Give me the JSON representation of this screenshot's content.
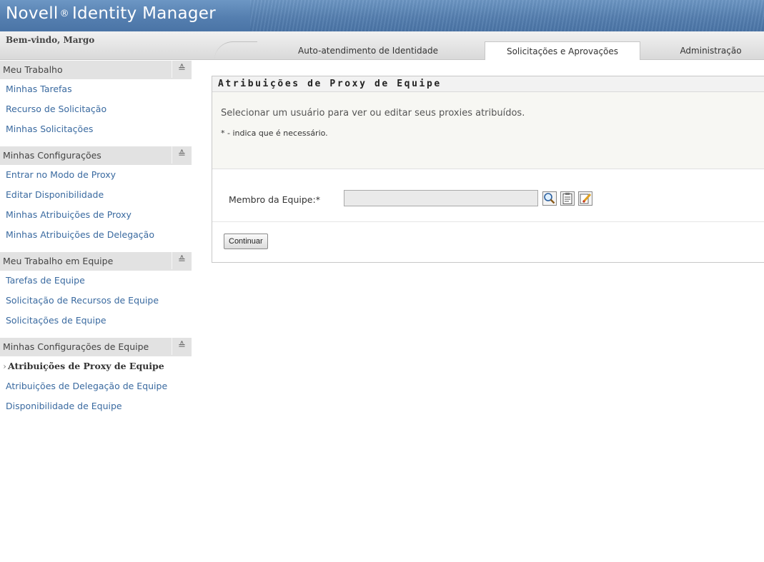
{
  "header": {
    "brand": "Novell",
    "registered_mark": "®",
    "product": "Identity Manager"
  },
  "navbar": {
    "welcome": "Bem-vindo, Margo",
    "tabs": [
      {
        "label": "Auto-atendimento de Identidade",
        "active": false
      },
      {
        "label": "Solicitações e Aprovações",
        "active": true
      },
      {
        "label": "Administração",
        "active": false
      }
    ]
  },
  "sidebar": {
    "collapse_glyph": "≈",
    "sections": [
      {
        "title": "Meu Trabalho",
        "items": [
          {
            "label": "Minhas Tarefas"
          },
          {
            "label": "Recurso de Solicitação"
          },
          {
            "label": "Minhas Solicitações"
          }
        ]
      },
      {
        "title": "Minhas Configurações",
        "items": [
          {
            "label": "Entrar no Modo de Proxy"
          },
          {
            "label": "Editar Disponibilidade"
          },
          {
            "label": "Minhas Atribuições de Proxy"
          },
          {
            "label": "Minhas Atribuições de Delegação"
          }
        ]
      },
      {
        "title": "Meu Trabalho em Equipe",
        "items": [
          {
            "label": "Tarefas de Equipe"
          },
          {
            "label": "Solicitação de Recursos de Equipe"
          },
          {
            "label": "Solicitações de Equipe"
          }
        ]
      },
      {
        "title": "Minhas Configurações de Equipe",
        "items": [
          {
            "label": "Atribuições de Proxy de Equipe",
            "active": true
          },
          {
            "label": "Atribuições de Delegação de Equipe"
          },
          {
            "label": "Disponibilidade de Equipe"
          }
        ]
      }
    ]
  },
  "main": {
    "title": "Atribuições de Proxy de Equipe",
    "description": "Selecionar um usuário para ver ou editar seus proxies atribuídos.",
    "required_note": "* - indica que é necessário.",
    "member_label": "Membro da Equipe:*",
    "member_value": "",
    "continue_label": "Continuar"
  },
  "icons": {
    "lookup": "magnifier-icon",
    "history": "clipboard-history-icon",
    "clear": "edit-clear-icon"
  },
  "colors": {
    "header_blue": "#5a84b5",
    "link_blue": "#3a6aa0",
    "section_gray": "#e2e2e2"
  }
}
